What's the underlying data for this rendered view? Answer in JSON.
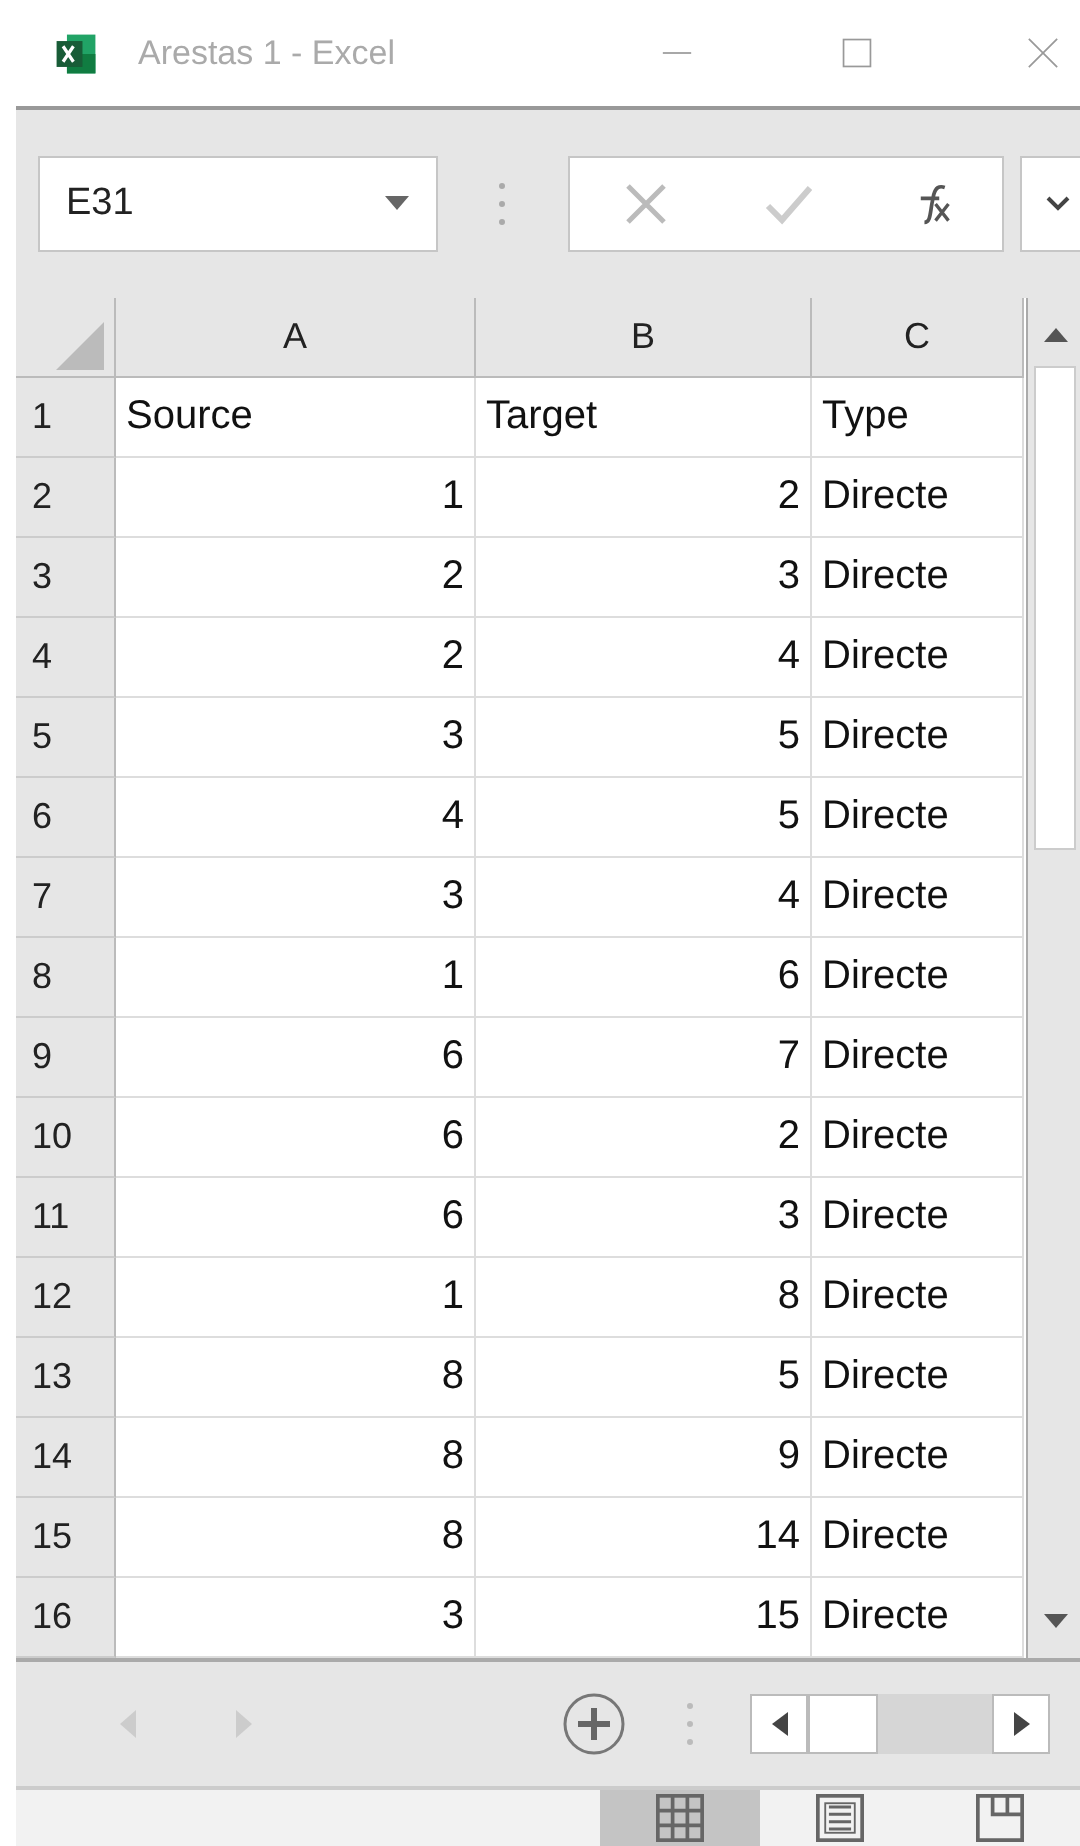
{
  "window": {
    "title": "Arestas 1 - Excel"
  },
  "name_box": {
    "value": "E31"
  },
  "columns": [
    "A",
    "B",
    "C"
  ],
  "rows": [
    {
      "number": "1",
      "cells": [
        "Source",
        "Target",
        "Type"
      ],
      "kind": "header"
    },
    {
      "number": "2",
      "cells": [
        "1",
        "2",
        "Directe"
      ],
      "kind": "data"
    },
    {
      "number": "3",
      "cells": [
        "2",
        "3",
        "Directe"
      ],
      "kind": "data"
    },
    {
      "number": "4",
      "cells": [
        "2",
        "4",
        "Directe"
      ],
      "kind": "data"
    },
    {
      "number": "5",
      "cells": [
        "3",
        "5",
        "Directe"
      ],
      "kind": "data"
    },
    {
      "number": "6",
      "cells": [
        "4",
        "5",
        "Directe"
      ],
      "kind": "data"
    },
    {
      "number": "7",
      "cells": [
        "3",
        "4",
        "Directe"
      ],
      "kind": "data"
    },
    {
      "number": "8",
      "cells": [
        "1",
        "6",
        "Directe"
      ],
      "kind": "data"
    },
    {
      "number": "9",
      "cells": [
        "6",
        "7",
        "Directe"
      ],
      "kind": "data"
    },
    {
      "number": "10",
      "cells": [
        "6",
        "2",
        "Directe"
      ],
      "kind": "data"
    },
    {
      "number": "11",
      "cells": [
        "6",
        "3",
        "Directe"
      ],
      "kind": "data"
    },
    {
      "number": "12",
      "cells": [
        "1",
        "8",
        "Directe"
      ],
      "kind": "data"
    },
    {
      "number": "13",
      "cells": [
        "8",
        "5",
        "Directe"
      ],
      "kind": "data"
    },
    {
      "number": "14",
      "cells": [
        "8",
        "9",
        "Directe"
      ],
      "kind": "data"
    },
    {
      "number": "15",
      "cells": [
        "8",
        "14",
        "Directe"
      ],
      "kind": "data"
    },
    {
      "number": "16",
      "cells": [
        "3",
        "15",
        "Directe"
      ],
      "kind": "data"
    }
  ],
  "views": [
    {
      "kind": "normal",
      "selected": true
    },
    {
      "kind": "page-layout",
      "selected": false
    },
    {
      "kind": "page-break",
      "selected": false
    }
  ]
}
